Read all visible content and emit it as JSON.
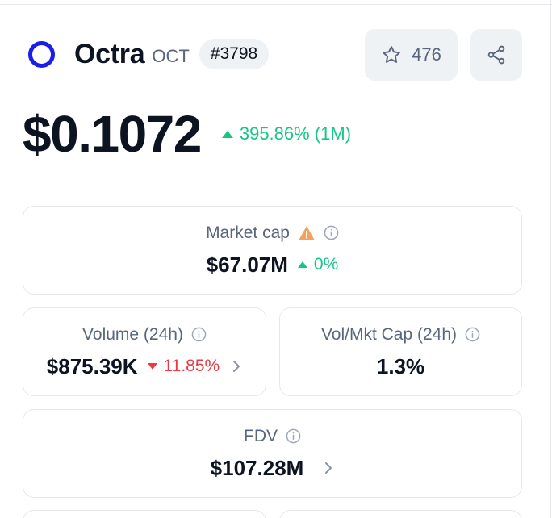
{
  "coin": {
    "name": "Octra",
    "symbol": "OCT",
    "rank": "#3798",
    "logo_color": "#1b1ee8"
  },
  "actions": {
    "watchlist_count": "476",
    "watch_icon": "star-icon",
    "share_icon": "share-icon"
  },
  "price": {
    "value": "$0.1072",
    "change": "395.86% (1M)",
    "direction": "up"
  },
  "stats": {
    "market_cap": {
      "label": "Market cap",
      "value": "$67.07M",
      "change": "0%",
      "direction": "up",
      "warning": true
    },
    "volume_24h": {
      "label": "Volume (24h)",
      "value": "$875.39K",
      "change": "11.85%",
      "direction": "down"
    },
    "vol_mkt_cap": {
      "label": "Vol/Mkt Cap (24h)",
      "value": "1.3%"
    },
    "fdv": {
      "label": "FDV",
      "value": "$107.28M"
    }
  },
  "colors": {
    "positive": "#16c784",
    "negative": "#ea3943",
    "muted_text": "#58667e",
    "primary_text": "#0d1421",
    "button_bg": "#eff2f5",
    "border": "#e6e8ec",
    "warning": "#f0a35e"
  }
}
